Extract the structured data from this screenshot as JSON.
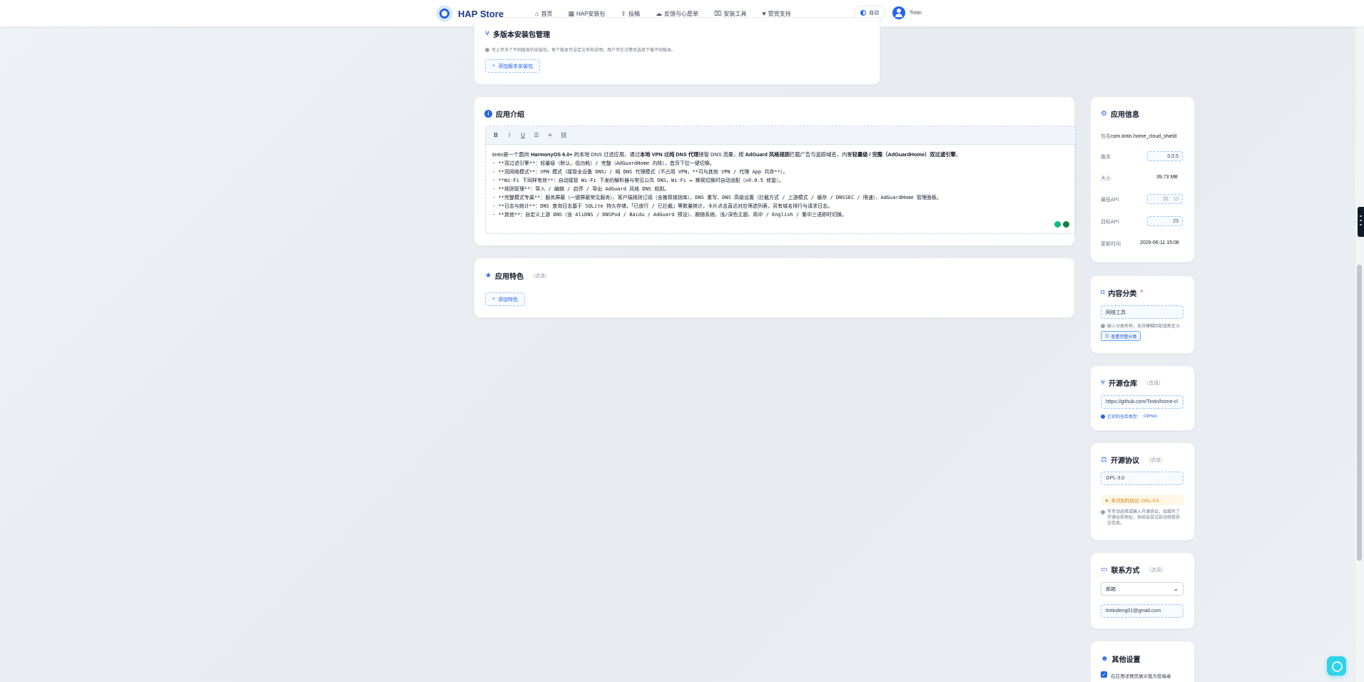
{
  "navbar": {
    "brand": "HAP Store",
    "items": [
      {
        "icon": "home-icon",
        "glyph": "⌂",
        "label": "首页"
      },
      {
        "icon": "grid-icon",
        "glyph": "▦",
        "label": "HAP安装包"
      },
      {
        "icon": "upload-icon",
        "glyph": "⇪",
        "label": "投稿"
      },
      {
        "icon": "chat-icon",
        "glyph": "☁",
        "label": "反馈与心愿单"
      },
      {
        "icon": "toolbox-icon",
        "glyph": "⌧",
        "label": "安装工具"
      },
      {
        "icon": "heart-icon",
        "glyph": "♥",
        "label": "赞赏支持"
      }
    ],
    "theme_label": "自动",
    "username": "Tintin"
  },
  "multi_version": {
    "title": "多版本安装包管理",
    "hint": "可上传多个不同版本的安装包。每个版本可设定文名和说明。用户可在详情页选择下载不同版本。",
    "add_button": "添加版本安装包"
  },
  "intro": {
    "title": "应用介绍",
    "toolbar": [
      "B",
      "I",
      "U",
      "☰",
      "≡",
      "⛓"
    ],
    "lines": [
      {
        "parts": [
          {
            "t": "tintin是一个面向 ",
            "b": false
          },
          {
            "t": "HarmonyOS 6.0+",
            "b": true
          },
          {
            "t": " 的本地 DNS 过滤应用，通过",
            "b": false
          },
          {
            "t": "本地 VPN",
            "b": true
          },
          {
            "t": " 或",
            "b": false
          },
          {
            "t": "纯 DNS 代理",
            "b": true
          },
          {
            "t": "接管 DNS 流量，按 ",
            "b": false
          },
          {
            "t": "AdGuard 风格规则",
            "b": true
          },
          {
            "t": "拦截广告与追踪域名，内置",
            "b": false
          },
          {
            "t": "轻量级 / 完整（AdGuardHome）双过滤引擎",
            "b": true
          },
          {
            "t": "。",
            "b": false
          }
        ]
      },
      {
        "mono": true,
        "text": "- **双过滤引擎**：轻量级（默认，低功耗）/ 完整（AdGuardHome 内核），首页下拉一键切换。"
      },
      {
        "mono": true,
        "text": "- **双网络模式**：VPN 模式（接管全设备 DNS）/ 纯 DNS 代理模式（不占用 VPN，**可与其他 VPN / 代理 App 共存**）。"
      },
      {
        "mono": true,
        "text": "- **Wi-Fi 下同样有效**：自动接管 Wi-Fi 下发的解析器与常见公共 DNS，Wi-Fi ↔ 蜂窝切换时自动适配（v0.0.5 修复）。"
      },
      {
        "mono": true,
        "text": "- **规则管理**：导入 / 编辑 / 启停 / 导出 AdGuard 风格 DNS 规则。"
      },
      {
        "mono": true,
        "text": "- **完整模式专属**：服务屏蔽（一键屏蔽常见服务）、客户端规则订阅（含推荐规则库）、DNS 重写、DNS 高级设置（拦截方式 / 上游模式 / 缓存 / DNSSEC / 限速）、AdGuardHome 管理面板。"
      },
      {
        "mono": true,
        "text": "- **日志与统计**：DNS 查询日志基于 SQLite 持久存储，「已放行 / 已拦截」等数量统计，卡片点击直达对应筛选列表，另有域名排行与请求日志。"
      },
      {
        "mono": true,
        "text": "- **其他**：自定义上游 DNS（含 AliDNS / DNSPod / Baidu / AdGuard 预设）、跟随系统、浅/深色主题、简中 / English / 繁中三语即时切换。"
      }
    ]
  },
  "features": {
    "title": "应用特色",
    "optional": "（选填）",
    "add_button": "添加特色"
  },
  "app_info": {
    "title": "应用信息",
    "package_label": "包名",
    "package_value": "com.tintin.home_cloud_shield",
    "version_label": "版本",
    "version_value": "0.0.5",
    "size_label": "大小",
    "size_value": "39.73 MB",
    "min_api_label": "最低API",
    "min_api_value": "例：10",
    "target_api_label": "目标API",
    "target_api_value": "23",
    "updated_label": "更新时间",
    "updated_value": "2026-06-11 15:08"
  },
  "category": {
    "title": "内容分类",
    "required_mark": "*",
    "value": "网络工具",
    "hint": "输入分类名称，支持模糊匹配或新定义",
    "button": "查看完整分类"
  },
  "repo": {
    "title": "开源仓库",
    "optional": "（选填）",
    "value": "https://github.com/Tintin/home-cl",
    "hint_prefix": "已识别仓库类型：",
    "hint_value": "GitHub"
  },
  "license": {
    "title": "开源协议",
    "optional": "（选填）",
    "value": "GPL-3.0",
    "warning": "未识别的协议: GPL-3.0",
    "hint": "可手动选择或输入开源协议，如填写了开源仓库地址，系统会尝试自动获取协议信息。"
  },
  "contact": {
    "title": "联系方式",
    "optional": "（选填）",
    "type": "邮箱",
    "value": "tintindeng01@gmail.com"
  },
  "other": {
    "title": "其他设置",
    "checkbox_label": "在应用详情页展示我为投稿者"
  }
}
